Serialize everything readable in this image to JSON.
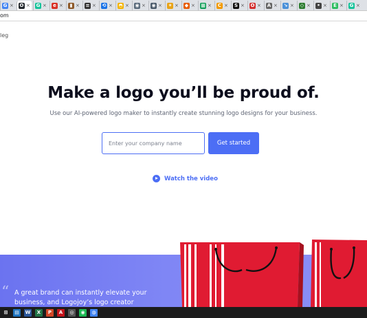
{
  "browser": {
    "tabs": [
      {
        "icon": "google-icon",
        "glyph": "G",
        "color": "#4285f4"
      },
      {
        "icon": "github-icon",
        "glyph": "O",
        "color": "#24292e"
      },
      {
        "icon": "grammarly-icon",
        "glyph": "G",
        "color": "#15c39a"
      },
      {
        "icon": "site-icon",
        "glyph": "e",
        "color": "#d93025"
      },
      {
        "icon": "chart-icon",
        "glyph": "▮",
        "color": "#8e5a2b"
      },
      {
        "icon": "document-icon",
        "glyph": "≡",
        "color": "#333333"
      },
      {
        "icon": "link-icon",
        "glyph": "⟲",
        "color": "#1a73e8"
      },
      {
        "icon": "rainbow-icon",
        "glyph": "◓",
        "color": "#f4b400"
      },
      {
        "icon": "steam-icon",
        "glyph": "◉",
        "color": "#5a6b7c"
      },
      {
        "icon": "steam-icon",
        "glyph": "◉",
        "color": "#4a5a6a"
      },
      {
        "icon": "star-icon",
        "glyph": "✶",
        "color": "#e8a317"
      },
      {
        "icon": "flag-icon",
        "glyph": "◆",
        "color": "#e85d04"
      },
      {
        "icon": "grid-icon",
        "glyph": "▦",
        "color": "#0f9d58"
      },
      {
        "icon": "coin-icon",
        "glyph": "C",
        "color": "#f29900"
      },
      {
        "icon": "sp-icon",
        "glyph": "S",
        "color": "#111111"
      },
      {
        "icon": "opera-icon",
        "glyph": "O",
        "color": "#d32f2f"
      },
      {
        "icon": "text-icon",
        "glyph": "A",
        "color": "#666666"
      },
      {
        "icon": "arrow-icon",
        "glyph": "↘",
        "color": "#4a90d9"
      },
      {
        "icon": "shield-icon",
        "glyph": "◇",
        "color": "#2e7d32"
      },
      {
        "icon": "dots-icon",
        "glyph": "•",
        "color": "#444444"
      },
      {
        "icon": "evernote-icon",
        "glyph": "E",
        "color": "#2dbe60"
      },
      {
        "icon": "grammarly-icon",
        "glyph": "G",
        "color": "#15c39a"
      }
    ],
    "url": "om"
  },
  "page": {
    "brand_fragment": "leg",
    "hero_title": "Make a logo you’ll be proud of.",
    "hero_subtitle": "Use our AI-powered logo maker to instantly create stunning logo designs for your business.",
    "company_input_placeholder": "Enter your company name",
    "company_input_value": "",
    "get_started_label": "Get started",
    "watch_video_label": "Watch the video",
    "quote_glyph": "“",
    "band_text": "A great brand can instantly elevate your business, and Logojoy’s logo creator",
    "accent_color": "#4c6ef5",
    "band_color": "#7b82f4",
    "bag_color": "#e01b32"
  },
  "taskbar": {
    "icons": [
      {
        "icon": "windows-start-icon",
        "glyph": "⊞",
        "color": "#1c1c1c"
      },
      {
        "icon": "file-explorer-icon",
        "glyph": "▤",
        "color": "#1e73be"
      },
      {
        "icon": "word-icon",
        "glyph": "W",
        "color": "#2b579a"
      },
      {
        "icon": "excel-icon",
        "glyph": "X",
        "color": "#217346"
      },
      {
        "icon": "powerpoint-icon",
        "glyph": "P",
        "color": "#d24726"
      },
      {
        "icon": "acrobat-icon",
        "glyph": "A",
        "color": "#c4151c"
      },
      {
        "icon": "globe-icon",
        "glyph": "◎",
        "color": "#555555"
      },
      {
        "icon": "spotify-icon",
        "glyph": "◉",
        "color": "#1db954"
      },
      {
        "icon": "chrome-icon",
        "glyph": "◍",
        "color": "#4285f4"
      }
    ]
  }
}
